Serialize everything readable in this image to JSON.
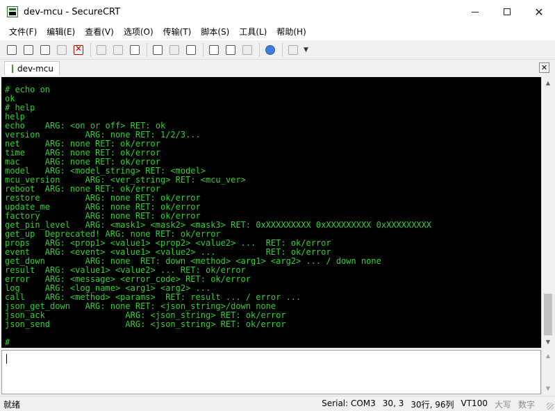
{
  "window": {
    "title": "dev-mcu - SecureCRT",
    "minimize_icon": "minimize-icon",
    "maximize_icon": "maximize-icon",
    "close_icon": "close-icon"
  },
  "menu": [
    {
      "label": "文件(F)"
    },
    {
      "label": "编辑(E)"
    },
    {
      "label": "查看(V)"
    },
    {
      "label": "选项(O)"
    },
    {
      "label": "传输(T)"
    },
    {
      "label": "脚本(S)"
    },
    {
      "label": "工具(L)"
    },
    {
      "label": "帮助(H)"
    }
  ],
  "toolbar": {
    "icons": [
      "connect-icon",
      "quick-connect-icon",
      "connect-tab-icon",
      "reconnect-icon",
      "disconnect-icon",
      "copy-icon",
      "paste-icon",
      "find-icon",
      "print-icon",
      "print-setup-icon",
      "print-selection-icon",
      "session-options-icon",
      "global-options-icon",
      "keymap-icon",
      "help-icon",
      "customize-icon"
    ]
  },
  "tabs": [
    {
      "label": "dev-mcu",
      "status_color": "#2da82d"
    }
  ],
  "terminal": {
    "text_color": "#2fd22f",
    "background": "#000000",
    "lines": [
      "# echo on",
      "ok",
      "# help",
      "help",
      "echo    ARG: <on or off> RET: ok",
      "version         ARG: none RET: 1/2/3...",
      "net     ARG: none RET: ok/error",
      "time    ARG: none RET: ok/error",
      "mac     ARG: none RET: ok/error",
      "model   ARG: <model_string> RET: <model>",
      "mcu_version     ARG: <ver_string> RET: <mcu_ver>",
      "reboot  ARG: none RET: ok/error",
      "restore         ARG: none RET: ok/error",
      "update_me       ARG: none RET: ok/error",
      "factory         ARG: none RET: ok/error",
      "get_pin_level   ARG: <mask1> <mask2> <mask3> RET: 0xXXXXXXXXX 0xXXXXXXXXX 0xXXXXXXXXX",
      "get_up  Deprecated! ARG: none RET: ok/error",
      "props   ARG: <prop1> <value1> <prop2> <value2> ...  RET: ok/error",
      "event   ARG: <event> <value1> <value2> ...          RET: ok/error",
      "get_down        ARG: none  RET: down <method> <arg1> <arg2> ... / down none",
      "result  ARG: <value1> <value2> ... RET: ok/error",
      "error   ARG: <message> <error_code> RET: ok/error",
      "log     ARG: <log_name> <arg1> <arg2> ...",
      "call    ARG: <method> <params>  RET: result ... / error ...",
      "json_get_down   ARG: none RET: <json_string>/down none",
      "json_ack                ARG: <json_string> RET: ok/error",
      "json_send               ARG: <json_string> RET: ok/error",
      "",
      "#"
    ]
  },
  "status": {
    "ready": "就绪",
    "connection": "Serial: COM3",
    "cursor": "30,  3",
    "size": "30行, 96列",
    "emulation": "VT100",
    "caps": "大写",
    "num": "数字"
  }
}
